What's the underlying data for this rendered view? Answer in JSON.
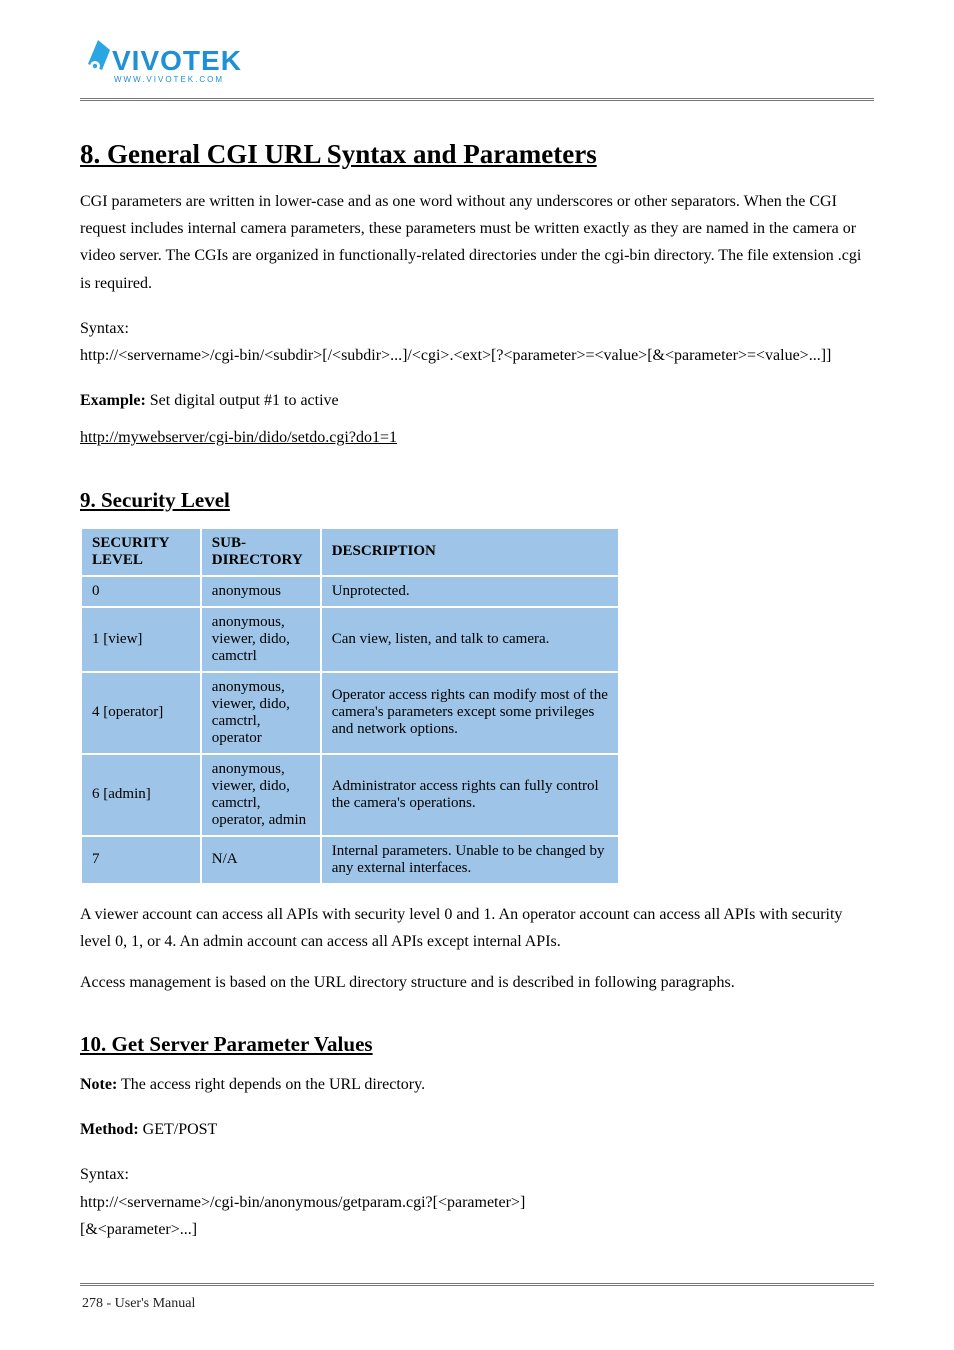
{
  "logo": {
    "name": "VIVOTEK",
    "tagline": "www.vivotek.com"
  },
  "h1": "8. General CGI URL Syntax and Parameters",
  "intro1": "CGI parameters are written in lower-case and as one word without any underscores or other separators. When the CGI request includes internal camera parameters, these parameters must be written exactly as they are named in the camera or video server. The CGIs are organized in functionally-related directories under the cgi-bin directory. The file extension .cgi is required.",
  "syntaxLabel": "Syntax:",
  "syntax1": "http://<servername>/cgi-bin/<subdir>[/<subdir>...]/<cgi>.<ext>[?<parameter>=<value>[&<parameter>=<value>...]]",
  "example1Label": "Example:",
  "example1Desc": "Set digital output #1 to active",
  "example1Url": "http://mywebserver/cgi-bin/dido/setdo.cgi?do1=1",
  "h2_security": "9. Security Level",
  "tableHeaders": {
    "c1": "SECURITY LEVEL",
    "c2": "SUB-DIRECTORY",
    "c3": "DESCRIPTION"
  },
  "rows": [
    {
      "c1": "0",
      "c2": "anonymous",
      "c3": "Unprotected."
    },
    {
      "c1": "1 [view]",
      "c2": "anonymous, viewer, dido, camctrl",
      "c3": "Can view, listen, and talk to camera."
    },
    {
      "c1": "4 [operator]",
      "c2": "anonymous, viewer, dido, camctrl, operator",
      "c3": "Operator access rights can modify most of the camera's parameters except some privileges and network options."
    },
    {
      "c1": "6 [admin]",
      "c2": "anonymous, viewer, dido, camctrl, operator, admin",
      "c3": "Administrator access rights can fully control the camera's operations."
    },
    {
      "c1": "7",
      "c2": "N/A",
      "c3": "Internal parameters. Unable to be changed by any external interfaces."
    }
  ],
  "tableNote": "A viewer account can access all APIs with security level 0 and 1. An operator account can access all APIs with security level 0, 1, or 4. An admin account can access all APIs except internal APIs.",
  "accessNote": "Access management is based on the URL directory structure and is described in following paragraphs.",
  "h2_getset": "10. Get Server Parameter Values",
  "noteLine": {
    "label": "Note:",
    "text": " The access right depends on the URL directory."
  },
  "methodLabel": "Method:",
  "methodText": " GET/POST",
  "syntaxLabel2": "Syntax:",
  "syntax2a": "http://<servername>/cgi-bin/anonymous/getparam.cgi?[<parameter>]",
  "syntax2b": "[&<parameter>...]",
  "footerLeft": "278 - User's Manual",
  "footerRight": ""
}
